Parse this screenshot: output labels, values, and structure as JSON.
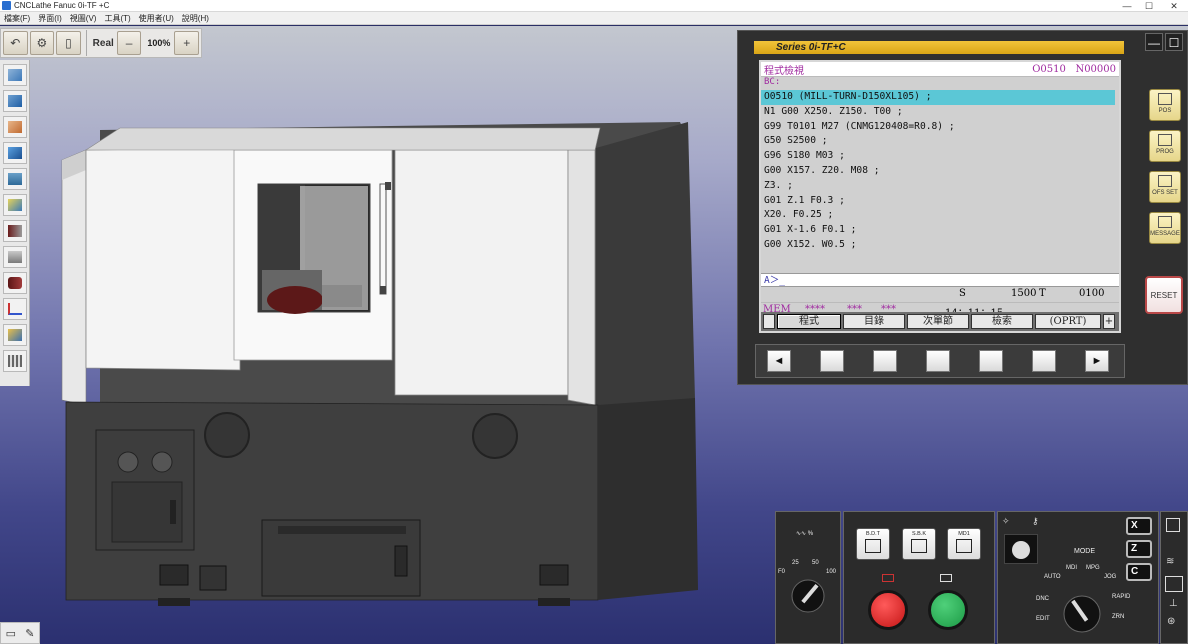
{
  "window": {
    "title": "CNCLathe Fanuc 0i-TF +C",
    "controls": [
      "—",
      "☐",
      "✕"
    ]
  },
  "menu": [
    "檔案(F)",
    "界面(I)",
    "視圖(V)",
    "工具(T)",
    "使用者(U)",
    "說明(H)"
  ],
  "toolbar": {
    "real_label": "Real",
    "minus_label": "–",
    "zoom": "100%",
    "plus_label": "+"
  },
  "cnc": {
    "series": "Series 0i-TF+C",
    "screen_title": "程式檢視",
    "program_number": "O0510",
    "sequence_number": "N00000",
    "bc_label": "BC:",
    "program_lines": [
      "O0510 (MILL-TURN-D150XL105) ;",
      "N1 G00 X250. Z150. T00 ;",
      "G99 T0101 M27 (CNMG120408=R0.8) ;",
      "G50 S2500 ;",
      "G96 S180 M03 ;",
      "G00 X157. Z20. M08 ;",
      "Z3. ;",
      "G01 Z.1 F0.3 ;",
      "X20. F0.25 ;",
      "G01 X-1.6 F0.1 ;",
      "G00 X152. W0.5 ;"
    ],
    "input_prompt": "A＞_",
    "s_label": "S",
    "s_value": "1500",
    "t_label": "T",
    "t_value": "0100",
    "mode": "MEM",
    "stars1": "****",
    "stars2": "***",
    "stars3": "***",
    "clock": "14：11：15",
    "softkeys": [
      "程式",
      "目錄",
      "次單節",
      "檢索",
      "(OPRT)"
    ],
    "softkey_left": "",
    "softkey_right": "+",
    "right_keys": [
      "POS",
      "PROG",
      "OFS SET",
      "MESSAGE"
    ],
    "reset_label": "RESET",
    "nav_left": "◄",
    "nav_right": "►",
    "head_controls": [
      "—",
      "☐"
    ]
  },
  "operator": {
    "feed_label": "∿∿ %",
    "feed_marks": [
      "F0",
      "25",
      "50",
      "100"
    ],
    "bdt_label": "B.D.T",
    "sbk_label": "S.B.K",
    "md1_label": "MD1",
    "mode_title": "MODE",
    "modes": [
      "AUTO",
      "MDI",
      "MPG",
      "JOG",
      "RAPID",
      "ZRN",
      "DNC",
      "EDIT"
    ],
    "axes": [
      "X",
      "Z",
      "C"
    ]
  }
}
